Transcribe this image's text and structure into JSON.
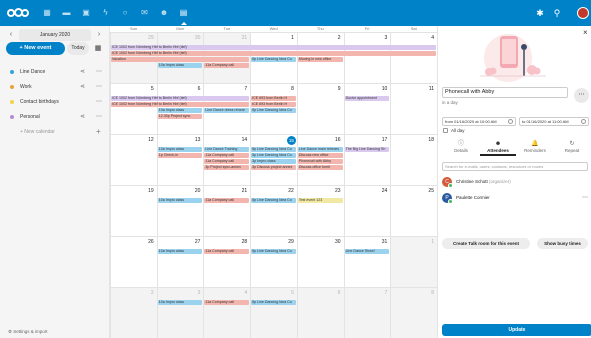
{
  "topbar": {
    "apps": [
      {
        "name": "dashboard-app-icon",
        "glyph": "▦"
      },
      {
        "name": "files-app-icon",
        "glyph": "▬"
      },
      {
        "name": "photos-app-icon",
        "glyph": "▣"
      },
      {
        "name": "activity-app-icon",
        "glyph": "ϟ"
      },
      {
        "name": "search-app-icon",
        "glyph": "○"
      },
      {
        "name": "mail-app-icon",
        "glyph": "✉"
      },
      {
        "name": "contacts-app-icon",
        "glyph": "☻"
      },
      {
        "name": "calendar-app-icon",
        "glyph": "▤"
      }
    ]
  },
  "sidebar": {
    "month_label": "January 2020",
    "new_event_label": "+ New event",
    "today_label": "Today",
    "calendars": [
      {
        "label": "Line Dance",
        "color": "#36a3d8",
        "shared": true
      },
      {
        "label": "Work",
        "color": "#e8a33d",
        "shared": true
      },
      {
        "label": "Contact birthdays",
        "color": "#f1d44a",
        "shared": false
      },
      {
        "label": "Personal",
        "color": "#b68ad8",
        "shared": true
      }
    ],
    "new_calendar_label": "+ New calendar",
    "settings_label": "Settings & import"
  },
  "calendar": {
    "weekdays": [
      "Sun",
      "Mon",
      "Tue",
      "Wed",
      "Thu",
      "Fri",
      "Sat"
    ],
    "weeks": [
      {
        "days": [
          {
            "num": "29",
            "muted": true
          },
          {
            "num": "30",
            "muted": true
          },
          {
            "num": "31",
            "muted": true
          },
          {
            "num": "1"
          },
          {
            "num": "2"
          },
          {
            "num": "3"
          },
          {
            "num": "4"
          }
        ],
        "events": [
          {
            "text": "ICE 1002 from Nürnberg Hbf to Berlin Hbf (tief)",
            "color": "lilac",
            "start": 0,
            "span": 7,
            "row": 0
          },
          {
            "text": "ICE 1002 from Nürnberg Hbf to Berlin Hbf (tief)",
            "color": "salmon",
            "start": 0,
            "span": 7,
            "row": 1
          },
          {
            "text": "Vacation",
            "color": "salmon",
            "start": 0,
            "span": 3,
            "row": 2
          },
          {
            "text": "5p Line Dancing Idea Co",
            "color": "blue",
            "start": 3,
            "span": 1,
            "row": 2
          },
          {
            "text": "Moving in new office",
            "color": "salmon",
            "start": 4,
            "span": 1,
            "row": 2
          },
          {
            "text": "10a Impro class",
            "color": "blue",
            "start": 1,
            "span": 1,
            "row": 3
          },
          {
            "text": "11a Company call",
            "color": "salmon",
            "start": 2,
            "span": 1,
            "row": 3
          }
        ]
      },
      {
        "days": [
          {
            "num": "5"
          },
          {
            "num": "6"
          },
          {
            "num": "7"
          },
          {
            "num": "8"
          },
          {
            "num": "9"
          },
          {
            "num": "10"
          },
          {
            "num": "11"
          }
        ],
        "events": [
          {
            "text": "ICE 1002 from Nürnberg Hbf to Berlin Hbf (tief)",
            "color": "lilac",
            "start": 0,
            "span": 3,
            "row": 0
          },
          {
            "text": "ICE 693 from Berlin H",
            "color": "salmon",
            "start": 3,
            "span": 1,
            "row": 0
          },
          {
            "text": "Doctor appointment",
            "color": "lilac",
            "start": 5,
            "span": 1,
            "row": 0
          },
          {
            "text": "ICE 1002 from Nürnberg Hbf to Berlin Hbf (tief)",
            "color": "salmon",
            "start": 0,
            "span": 3,
            "row": 1
          },
          {
            "text": "ICE 693 from Berlin H",
            "color": "salmon",
            "start": 3,
            "span": 1,
            "row": 1
          },
          {
            "text": "10a Impro class",
            "color": "blue",
            "start": 1,
            "span": 1,
            "row": 2
          },
          {
            "text": "Line Dance dress rehear",
            "color": "blue",
            "start": 2,
            "span": 1,
            "row": 2
          },
          {
            "text": "5p Line Dancing Idea Co",
            "color": "blue",
            "start": 3,
            "span": 1,
            "row": 2
          },
          {
            "text": "12.30p Project sync",
            "color": "salmon",
            "start": 1,
            "span": 1,
            "row": 3
          }
        ]
      },
      {
        "days": [
          {
            "num": "12"
          },
          {
            "num": "13"
          },
          {
            "num": "14"
          },
          {
            "num": "15",
            "today": true
          },
          {
            "num": "16"
          },
          {
            "num": "17"
          },
          {
            "num": "18"
          }
        ],
        "events": [
          {
            "text": "10a Impro class",
            "color": "blue",
            "start": 1,
            "span": 1,
            "row": 0
          },
          {
            "text": "Line Dance Training",
            "color": "blue",
            "start": 2,
            "span": 1,
            "row": 0
          },
          {
            "text": "5p Line Dancing Idea Co",
            "color": "blue",
            "start": 3,
            "span": 1,
            "row": 0
          },
          {
            "text": "Line Dance main rehears",
            "color": "blue",
            "start": 4,
            "span": 1,
            "row": 0
          },
          {
            "text": "The Big Line Dancing Sh",
            "color": "lilac",
            "start": 5,
            "span": 1,
            "row": 0
          },
          {
            "text": "1p Check-in",
            "color": "salmon",
            "start": 1,
            "span": 1,
            "row": 1
          },
          {
            "text": "11a Company call",
            "color": "salmon",
            "start": 2,
            "span": 1,
            "row": 1
          },
          {
            "text": "5p Line Dancing Idea Co",
            "color": "blue",
            "start": 3,
            "span": 1,
            "row": 1
          },
          {
            "text": "Discuss new office",
            "color": "salmon",
            "start": 4,
            "span": 1,
            "row": 1
          },
          {
            "text": "11a Company call",
            "color": "salmon",
            "start": 2,
            "span": 1,
            "row": 2
          },
          {
            "text": "3p Impro class",
            "color": "blue",
            "start": 3,
            "span": 1,
            "row": 2
          },
          {
            "text": "Phonecall with Abby",
            "color": "salmon",
            "start": 4,
            "span": 1,
            "row": 2
          },
          {
            "text": "3p Project sync-annex",
            "color": "salmon",
            "start": 2,
            "span": 1,
            "row": 3
          },
          {
            "text": "3p Discuss project annex",
            "color": "salmon",
            "start": 3,
            "span": 1,
            "row": 3
          },
          {
            "text": "Discuss office furnit",
            "color": "salmon",
            "start": 4,
            "span": 1,
            "row": 3
          }
        ]
      },
      {
        "days": [
          {
            "num": "19"
          },
          {
            "num": "20"
          },
          {
            "num": "21"
          },
          {
            "num": "22"
          },
          {
            "num": "23"
          },
          {
            "num": "24"
          },
          {
            "num": "25"
          }
        ],
        "events": [
          {
            "text": "10a Impro class",
            "color": "blue",
            "start": 1,
            "span": 1,
            "row": 0
          },
          {
            "text": "11a Company call",
            "color": "salmon",
            "start": 2,
            "span": 1,
            "row": 0
          },
          {
            "text": "5p Line Dancing Idea Co",
            "color": "blue",
            "start": 3,
            "span": 1,
            "row": 0
          },
          {
            "text": "Test event 123",
            "color": "yellow",
            "start": 4,
            "span": 1,
            "row": 0
          }
        ]
      },
      {
        "days": [
          {
            "num": "26"
          },
          {
            "num": "27"
          },
          {
            "num": "28"
          },
          {
            "num": "29"
          },
          {
            "num": "30"
          },
          {
            "num": "31"
          },
          {
            "num": "1",
            "muted": true
          }
        ],
        "events": [
          {
            "text": "10a Impro class",
            "color": "blue",
            "start": 1,
            "span": 1,
            "row": 0
          },
          {
            "text": "11a Company call",
            "color": "salmon",
            "start": 2,
            "span": 1,
            "row": 0
          },
          {
            "text": "5p Line Dancing Idea Co",
            "color": "blue",
            "start": 3,
            "span": 1,
            "row": 0
          },
          {
            "text": "Line Dance Show!",
            "color": "blue",
            "start": 5,
            "span": 1,
            "row": 0
          }
        ]
      },
      {
        "days": [
          {
            "num": "2",
            "muted": true
          },
          {
            "num": "3",
            "muted": true
          },
          {
            "num": "4",
            "muted": true
          },
          {
            "num": "5",
            "muted": true
          },
          {
            "num": "6",
            "muted": true
          },
          {
            "num": "7",
            "muted": true
          },
          {
            "num": "8",
            "muted": true
          }
        ],
        "events": [
          {
            "text": "10a Impro class",
            "color": "blue",
            "start": 1,
            "span": 1,
            "row": 0
          },
          {
            "text": "11a Company call",
            "color": "salmon",
            "start": 2,
            "span": 1,
            "row": 0
          },
          {
            "text": "5p Line Dancing Idea Co",
            "color": "blue",
            "start": 3,
            "span": 1,
            "row": 0
          }
        ]
      }
    ]
  },
  "event_editor": {
    "title": "Phonecall with Abby",
    "subtitle": "in a day",
    "from": "from 01/16/2020 at 10:00 AM",
    "to": "to 01/16/2020 at 11:00 AM",
    "all_day_label": "All day",
    "tabs": [
      {
        "label": "Details",
        "icon": "ⓘ",
        "name": "details-icon"
      },
      {
        "label": "Attendees",
        "icon": "☻",
        "name": "attendees-icon",
        "active": true
      },
      {
        "label": "Reminders",
        "icon": "🔔",
        "name": "bell-icon"
      },
      {
        "label": "Repeat",
        "icon": "↻",
        "name": "repeat-icon"
      }
    ],
    "attendee_search_placeholder": "Search for e-mails, users, contacts, resources or rooms",
    "attendees": [
      {
        "initial": "C",
        "name": "Christine Schott",
        "role": "(organizer)",
        "avatar_color": "#d35a3d",
        "more": false
      },
      {
        "initial": "P",
        "name": "Paulette Cormier",
        "role": "",
        "avatar_color": "#2c5aa0",
        "more": true
      }
    ],
    "talk_room_label": "Create Talk room for this event",
    "busy_times_label": "Show busy times",
    "update_label": "Update"
  }
}
